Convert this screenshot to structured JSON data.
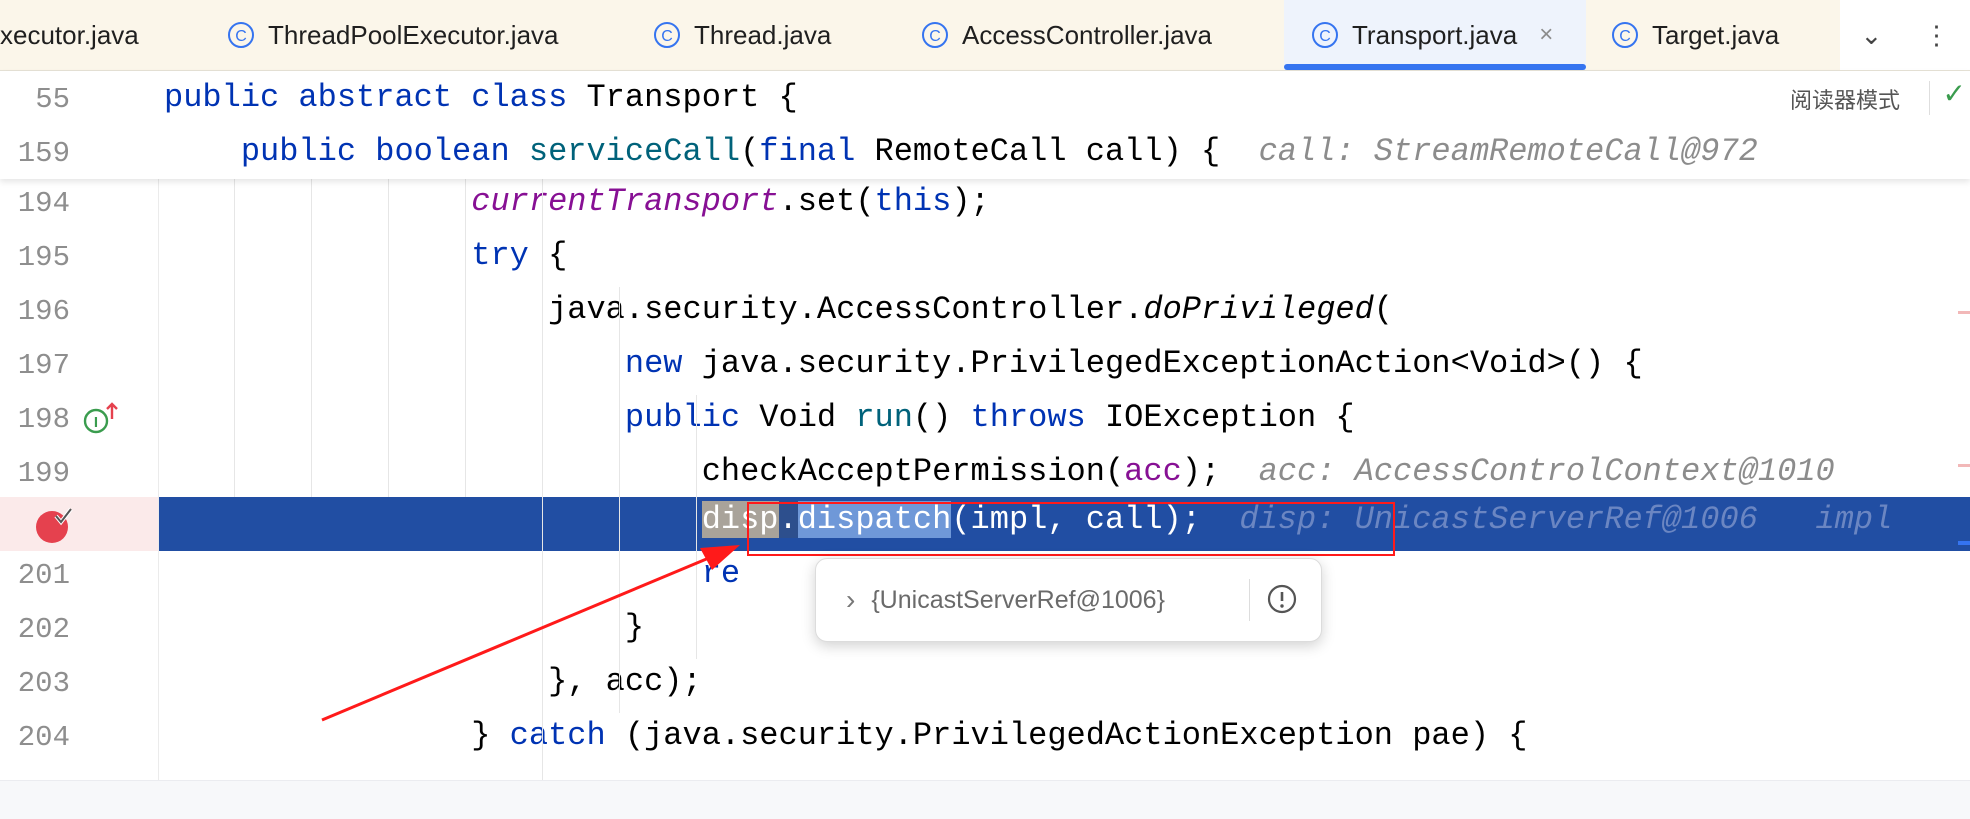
{
  "tabs": [
    {
      "label": "xecutor.java",
      "active": false
    },
    {
      "label": "ThreadPoolExecutor.java",
      "active": false
    },
    {
      "label": "Thread.java",
      "active": false
    },
    {
      "label": "AccessController.java",
      "active": false
    },
    {
      "label": "Transport.java",
      "active": true
    },
    {
      "label": "Target.java",
      "active": false
    }
  ],
  "tab_close_glyph": "×",
  "tab_menu_glyph": "⌄",
  "more_glyph": "⋮",
  "reader_mode": "阅读器模式",
  "check_glyph": "✓",
  "colors": {
    "keyword": "#0033b3",
    "method": "#00627a",
    "field": "#871094",
    "execution_line": "#214ea3",
    "breakpoint": "#e5414e",
    "annotation_red": "#ff0000",
    "active_tab_underline": "#3574f0"
  },
  "sticky_lines": [
    {
      "num": "55",
      "indent": "",
      "code": [
        {
          "t": "public abstract class ",
          "c": "kw"
        },
        {
          "t": "Transport {",
          "c": ""
        }
      ]
    },
    {
      "num": "159",
      "indent": "    ",
      "code": [
        {
          "t": "public boolean ",
          "c": "kw"
        },
        {
          "t": "serviceCall",
          "c": "fn"
        },
        {
          "t": "(",
          "c": ""
        },
        {
          "t": "final ",
          "c": "kw"
        },
        {
          "t": "RemoteCall call) {  ",
          "c": ""
        },
        {
          "t": "call: StreamRemoteCall@972",
          "c": "hint"
        }
      ]
    }
  ],
  "lines": [
    {
      "num": "194",
      "indent": "                ",
      "code": [
        {
          "t": "currentTransport",
          "c": "field"
        },
        {
          "t": ".set(",
          "c": ""
        },
        {
          "t": "this",
          "c": "kw"
        },
        {
          "t": ");",
          "c": ""
        }
      ]
    },
    {
      "num": "195",
      "indent": "                ",
      "code": [
        {
          "t": "try ",
          "c": "kw"
        },
        {
          "t": "{",
          "c": ""
        }
      ]
    },
    {
      "num": "196",
      "indent": "                    ",
      "code": [
        {
          "t": "java.security.AccessController.",
          "c": ""
        },
        {
          "t": "doPrivileged",
          "c": "it"
        },
        {
          "t": "(",
          "c": ""
        }
      ]
    },
    {
      "num": "197",
      "indent": "                        ",
      "code": [
        {
          "t": "new ",
          "c": "kw"
        },
        {
          "t": "java.security.PrivilegedExceptionAction<Void>() {",
          "c": ""
        }
      ]
    },
    {
      "num": "198",
      "indent": "                        ",
      "code": [
        {
          "t": "public ",
          "c": "kw"
        },
        {
          "t": "Void ",
          "c": ""
        },
        {
          "t": "run",
          "c": "fn"
        },
        {
          "t": "() ",
          "c": ""
        },
        {
          "t": "throws ",
          "c": "kw"
        },
        {
          "t": "IOException {",
          "c": ""
        }
      ]
    },
    {
      "num": "199",
      "indent": "                            ",
      "code": [
        {
          "t": "checkAcceptPermission(",
          "c": ""
        },
        {
          "t": "acc",
          "c": "field-plain"
        },
        {
          "t": ");  ",
          "c": ""
        },
        {
          "t": "acc: AccessControlContext@1010",
          "c": "hint"
        }
      ]
    },
    {
      "num": "",
      "indent": "                            ",
      "exec": true,
      "code": [
        {
          "t": "disp",
          "c": "sel-disp"
        },
        {
          "t": ".",
          "c": "sel-dot"
        },
        {
          "t": "dispatch",
          "c": "sel-dispatch"
        },
        {
          "t": "(impl, call);  ",
          "c": ""
        },
        {
          "t": "disp: UnicastServerRef@1006   impl",
          "c": "exec-hint"
        }
      ]
    },
    {
      "num": "201",
      "indent": "                            ",
      "code": [
        {
          "t": "re",
          "c": "kw"
        }
      ]
    },
    {
      "num": "202",
      "indent": "                        ",
      "code": [
        {
          "t": "}",
          "c": ""
        }
      ]
    },
    {
      "num": "203",
      "indent": "                    ",
      "code": [
        {
          "t": "}, acc);",
          "c": ""
        }
      ]
    },
    {
      "num": "204",
      "indent": "                ",
      "code": [
        {
          "t": "} ",
          "c": ""
        },
        {
          "t": "catch ",
          "c": "kw"
        },
        {
          "t": "(java.security.PrivilegedActionException pae) {",
          "c": ""
        }
      ]
    }
  ],
  "popup": {
    "value": "{UnicastServerRef@1006}",
    "expand_glyph": "›",
    "info_glyph": "!"
  }
}
